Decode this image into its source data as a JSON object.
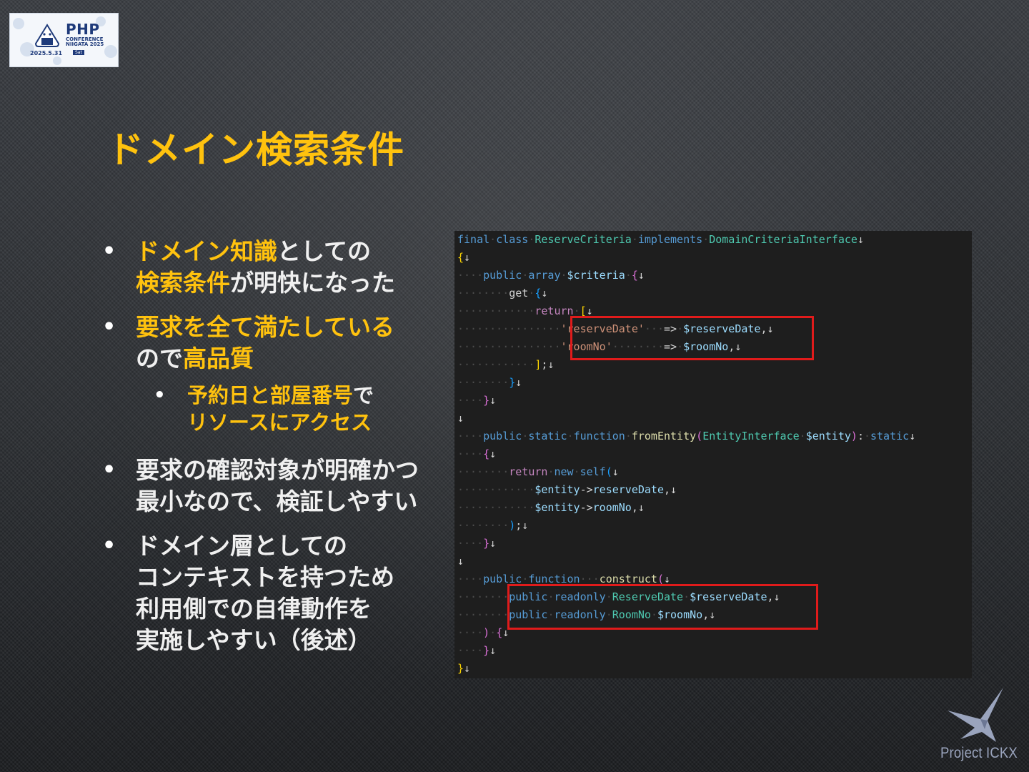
{
  "logo": {
    "brand": "PHP",
    "sub": "CONFERENCE NIIGATA 2025",
    "date": "2025.5.31",
    "day": "Sat"
  },
  "title": "ドメイン検索条件",
  "bullets": [
    {
      "lines": [
        [
          {
            "t": "ドメイン知識",
            "hl": true
          },
          {
            "t": "としての",
            "hl": false
          }
        ],
        [
          {
            "t": "検索条件",
            "hl": true
          },
          {
            "t": "が明快になった",
            "hl": false
          }
        ]
      ]
    },
    {
      "lines": [
        [
          {
            "t": "要求を全て満たしている",
            "hl": true
          }
        ],
        [
          {
            "t": "ので",
            "hl": false
          },
          {
            "t": "高品質",
            "hl": true
          }
        ]
      ]
    },
    {
      "sub": true,
      "lines": [
        [
          {
            "t": "予約日と部屋番号",
            "hl": true
          },
          {
            "t": "で",
            "hl": false
          }
        ],
        [
          {
            "t": "リソースにアクセス",
            "hl": true
          }
        ]
      ]
    },
    {
      "lines": [
        [
          {
            "t": "要求の確認対象が明確かつ",
            "hl": false
          }
        ],
        [
          {
            "t": "最小なので、検証しやすい",
            "hl": false
          }
        ]
      ]
    },
    {
      "lines": [
        [
          {
            "t": "ドメイン層としての",
            "hl": false
          }
        ],
        [
          {
            "t": "コンテキストを持つため",
            "hl": false
          }
        ],
        [
          {
            "t": "利用側での自律動作を",
            "hl": false
          }
        ],
        [
          {
            "t": "実施しやすい（後述）",
            "hl": false
          }
        ]
      ]
    }
  ],
  "code_lines": [
    [
      [
        "kw",
        "final"
      ],
      [
        "ws",
        "·"
      ],
      [
        "kw",
        "class"
      ],
      [
        "ws",
        "·"
      ],
      [
        "ty",
        "ReserveCriteria"
      ],
      [
        "ws",
        "·"
      ],
      [
        "kw",
        "implements"
      ],
      [
        "ws",
        "·"
      ],
      [
        "ty",
        "DomainCriteriaInterface"
      ],
      [
        "arr",
        "↓"
      ]
    ],
    [
      [
        "br1",
        "{"
      ],
      [
        "arr",
        "↓"
      ]
    ],
    [
      [
        "ws",
        "····"
      ],
      [
        "kw",
        "public"
      ],
      [
        "ws",
        "·"
      ],
      [
        "kw",
        "array"
      ],
      [
        "ws",
        "·"
      ],
      [
        "va",
        "$criteria"
      ],
      [
        "ws",
        "·"
      ],
      [
        "br2",
        "{"
      ],
      [
        "arr",
        "↓"
      ]
    ],
    [
      [
        "ws",
        "········"
      ],
      [
        "arr",
        "get"
      ],
      [
        "ws",
        "·"
      ],
      [
        "br3",
        "{"
      ],
      [
        "arr",
        "↓"
      ]
    ],
    [
      [
        "ws",
        "············"
      ],
      [
        "ctl",
        "return"
      ],
      [
        "ws",
        "·"
      ],
      [
        "br1",
        "["
      ],
      [
        "arr",
        "↓"
      ]
    ],
    [
      [
        "ws",
        "················"
      ],
      [
        "st",
        "'reserveDate'"
      ],
      [
        "ws",
        "···"
      ],
      [
        "arr",
        "=>"
      ],
      [
        "ws",
        "·"
      ],
      [
        "va",
        "$reserveDate"
      ],
      [
        "arr",
        ",↓"
      ]
    ],
    [
      [
        "ws",
        "················"
      ],
      [
        "st",
        "'roomNo'"
      ],
      [
        "ws",
        "········"
      ],
      [
        "arr",
        "=>"
      ],
      [
        "ws",
        "·"
      ],
      [
        "va",
        "$roomNo"
      ],
      [
        "arr",
        ",↓"
      ]
    ],
    [
      [
        "ws",
        "············"
      ],
      [
        "br1",
        "]"
      ],
      [
        "arr",
        ";↓"
      ]
    ],
    [
      [
        "ws",
        "········"
      ],
      [
        "br3",
        "}"
      ],
      [
        "arr",
        "↓"
      ]
    ],
    [
      [
        "ws",
        "····"
      ],
      [
        "br2",
        "}"
      ],
      [
        "arr",
        "↓"
      ]
    ],
    [
      [
        "arr",
        "↓"
      ]
    ],
    [
      [
        "ws",
        "····"
      ],
      [
        "kw",
        "public"
      ],
      [
        "ws",
        "·"
      ],
      [
        "kw",
        "static"
      ],
      [
        "ws",
        "·"
      ],
      [
        "kw",
        "function"
      ],
      [
        "ws",
        "·"
      ],
      [
        "fn",
        "fromEntity"
      ],
      [
        "br2",
        "("
      ],
      [
        "ty",
        "EntityInterface"
      ],
      [
        "ws",
        "·"
      ],
      [
        "va",
        "$entity"
      ],
      [
        "br2",
        ")"
      ],
      [
        "arr",
        ":"
      ],
      [
        "ws",
        "·"
      ],
      [
        "kw",
        "static"
      ],
      [
        "arr",
        "↓"
      ]
    ],
    [
      [
        "ws",
        "····"
      ],
      [
        "br2",
        "{"
      ],
      [
        "arr",
        "↓"
      ]
    ],
    [
      [
        "ws",
        "········"
      ],
      [
        "ctl",
        "return"
      ],
      [
        "ws",
        "·"
      ],
      [
        "kw",
        "new"
      ],
      [
        "ws",
        "·"
      ],
      [
        "kw",
        "self"
      ],
      [
        "br3",
        "("
      ],
      [
        "arr",
        "↓"
      ]
    ],
    [
      [
        "ws",
        "············"
      ],
      [
        "va",
        "$entity"
      ],
      [
        "arr",
        "->"
      ],
      [
        "va",
        "reserveDate"
      ],
      [
        "arr",
        ",↓"
      ]
    ],
    [
      [
        "ws",
        "············"
      ],
      [
        "va",
        "$entity"
      ],
      [
        "arr",
        "->"
      ],
      [
        "va",
        "roomNo"
      ],
      [
        "arr",
        ",↓"
      ]
    ],
    [
      [
        "ws",
        "········"
      ],
      [
        "br3",
        ")"
      ],
      [
        "arr",
        ";↓"
      ]
    ],
    [
      [
        "ws",
        "····"
      ],
      [
        "br2",
        "}"
      ],
      [
        "arr",
        "↓"
      ]
    ],
    [
      [
        "arr",
        "↓"
      ]
    ],
    [
      [
        "ws",
        "····"
      ],
      [
        "kw",
        "public"
      ],
      [
        "ws",
        "·"
      ],
      [
        "kw",
        "function"
      ],
      [
        "ws",
        "·"
      ],
      [
        "ws",
        "··"
      ],
      [
        "fn",
        "construct"
      ],
      [
        "br2",
        "("
      ],
      [
        "arr",
        "↓"
      ]
    ],
    [
      [
        "ws",
        "········"
      ],
      [
        "kw",
        "public"
      ],
      [
        "ws",
        "·"
      ],
      [
        "kw",
        "readonly"
      ],
      [
        "ws",
        "·"
      ],
      [
        "ty",
        "ReserveDate"
      ],
      [
        "ws",
        "·"
      ],
      [
        "va",
        "$reserveDate"
      ],
      [
        "arr",
        ",↓"
      ]
    ],
    [
      [
        "ws",
        "········"
      ],
      [
        "kw",
        "public"
      ],
      [
        "ws",
        "·"
      ],
      [
        "kw",
        "readonly"
      ],
      [
        "ws",
        "·"
      ],
      [
        "ty",
        "RoomNo"
      ],
      [
        "ws",
        "·"
      ],
      [
        "va",
        "$roomNo"
      ],
      [
        "arr",
        ",↓"
      ]
    ],
    [
      [
        "ws",
        "····"
      ],
      [
        "br2",
        ")"
      ],
      [
        "ws",
        "·"
      ],
      [
        "br2",
        "{"
      ],
      [
        "arr",
        "↓"
      ]
    ],
    [
      [
        "ws",
        "····"
      ],
      [
        "br2",
        "}"
      ],
      [
        "arr",
        "↓"
      ]
    ],
    [
      [
        "br1",
        "}"
      ],
      [
        "arr",
        "↓"
      ]
    ]
  ],
  "footer": {
    "brand": "Project ICKX"
  },
  "colors": {
    "accent": "#ffc20e",
    "highlight_box": "#e01b1b",
    "code_bg": "#1e1e1e"
  }
}
